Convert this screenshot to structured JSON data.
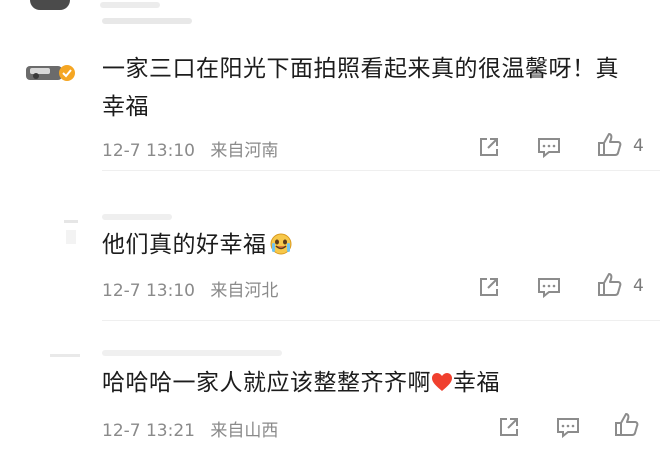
{
  "comments": [
    {
      "text": "一家三口在阳光下面拍照看起来真的很温馨呀！真幸福",
      "time": "12-7 13:10",
      "location": "来自河南",
      "likes": "4"
    },
    {
      "text": "他们真的好幸福",
      "time": "12-7 13:10",
      "location": "来自河北",
      "likes": "4"
    },
    {
      "text_before": "哈哈哈一家人就应该整整齐齐啊",
      "text_after": "幸福",
      "time": "12-7 13:21",
      "location": "来自山西",
      "likes": ""
    }
  ],
  "icons": {
    "share": "share-icon",
    "reply": "comment-icon",
    "like": "thumbs-up-icon",
    "verified_badge": "verified-badge-icon",
    "emoji": "crying-face-emoji",
    "heart": "heart-emoji"
  },
  "colors": {
    "text": "#1c1c1c",
    "meta": "#8a8a8a",
    "icon": "#8c8c8c",
    "verified": "#f5a623",
    "heart": "#f0402e"
  }
}
